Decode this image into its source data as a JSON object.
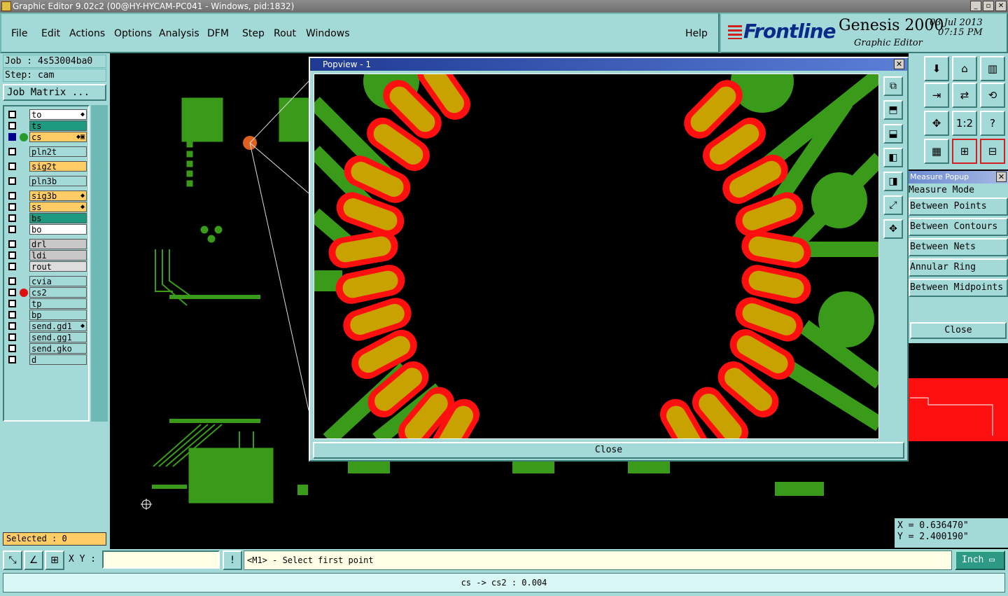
{
  "window": {
    "title": "Graphic Editor 9.02c2 (00@HY-HYCAM-PC041 - Windows, pid:1832)"
  },
  "menu": [
    {
      "label": "File"
    },
    {
      "label": "Edit"
    },
    {
      "label": "Actions"
    },
    {
      "label": "Options"
    },
    {
      "label": "Analysis"
    },
    {
      "label": "DFM"
    },
    {
      "label": "Step"
    },
    {
      "label": "Rout"
    },
    {
      "label": "Windows"
    },
    {
      "label": "Help"
    }
  ],
  "brand": {
    "logo": "Frontline",
    "product": "Genesis 2000",
    "date": "03 Jul 2013",
    "time": "07:15 PM",
    "subtitle": "Graphic Editor"
  },
  "job": {
    "job_label": "Job : 4s53004ba0",
    "step_label": "Step: cam",
    "matrix_button": "Job Matrix ..."
  },
  "layers": [
    {
      "name": "to",
      "color": "#ffffff",
      "dot": "",
      "flag": "◆",
      "selected": false
    },
    {
      "name": "ts",
      "color": "#1d9a80",
      "dot": "",
      "flag": "",
      "selected": false
    },
    {
      "name": "cs",
      "color": "#ffcc66",
      "dot": "#2a9a2a",
      "flag": "◆▣",
      "selected": true
    },
    {
      "name": "pln2t",
      "color": "#a3dad8",
      "dot": "",
      "flag": "",
      "selected": false
    },
    {
      "name": "sig2t",
      "color": "#ffcc66",
      "dot": "",
      "flag": "",
      "selected": false
    },
    {
      "name": "pln3b",
      "color": "#a3dad8",
      "dot": "",
      "flag": "",
      "selected": false
    },
    {
      "name": "sig3b",
      "color": "#ffcc66",
      "dot": "",
      "flag": "◆",
      "selected": false
    },
    {
      "name": "ss",
      "color": "#ffcc66",
      "dot": "",
      "flag": "◆",
      "selected": false
    },
    {
      "name": "bs",
      "color": "#1d9a80",
      "dot": "",
      "flag": "",
      "selected": false
    },
    {
      "name": "bo",
      "color": "#ffffff",
      "dot": "",
      "flag": "",
      "selected": false
    },
    {
      "name": "drl",
      "color": "#c8c8c8",
      "dot": "",
      "flag": "",
      "selected": false
    },
    {
      "name": "ldi",
      "color": "#c8c8c8",
      "dot": "",
      "flag": "",
      "selected": false
    },
    {
      "name": "rout",
      "color": "#dddddd",
      "dot": "",
      "flag": "",
      "selected": false
    },
    {
      "name": "cvia",
      "color": "#a3dad8",
      "dot": "",
      "flag": "",
      "selected": false
    },
    {
      "name": "cs2",
      "color": "#a3dad8",
      "dot": "#e01010",
      "flag": "",
      "selected": false
    },
    {
      "name": "tp",
      "color": "#a3dad8",
      "dot": "",
      "flag": "",
      "selected": false
    },
    {
      "name": "bp",
      "color": "#a3dad8",
      "dot": "",
      "flag": "",
      "selected": false
    },
    {
      "name": "send.gd1",
      "color": "#a3dad8",
      "dot": "",
      "flag": "◆",
      "selected": false
    },
    {
      "name": "send.gg1",
      "color": "#a3dad8",
      "dot": "",
      "flag": "",
      "selected": false
    },
    {
      "name": "send.gko",
      "color": "#a3dad8",
      "dot": "",
      "flag": "",
      "selected": false
    },
    {
      "name": "d",
      "color": "#a3dad8",
      "dot": "",
      "flag": "",
      "selected": false
    }
  ],
  "selected_label": "Selected : 0",
  "popview": {
    "title": "Popview - 1",
    "close_label": "Close"
  },
  "right_tools": [
    {
      "icon": "save-icon"
    },
    {
      "icon": "home-icon"
    },
    {
      "icon": "window-icon"
    },
    {
      "icon": "export-icon"
    },
    {
      "icon": "swap-icon"
    },
    {
      "icon": "snap-icon"
    },
    {
      "icon": "fit-icon"
    },
    {
      "icon": "scale-label",
      "text": "1:2"
    },
    {
      "icon": "help-icon",
      "text": "?"
    },
    {
      "icon": "grid-icon"
    },
    {
      "icon": "measure-icon"
    },
    {
      "icon": "measure-icon-2"
    }
  ],
  "measure": {
    "title": "Measure Popup",
    "mode_label": "Measure Mode",
    "options": [
      "Between Points",
      "Between Contours",
      "Between Nets",
      "Annular Ring",
      "Between Midpoints"
    ],
    "close_label": "Close"
  },
  "coords": {
    "x": "X = 0.636470\"",
    "y": "Y = 2.400190\""
  },
  "cmd": {
    "xy_label": "X Y :",
    "xy_value": "",
    "warn": "!",
    "prompt": "<M1> - Select first point",
    "unit": "Inch"
  },
  "status": "cs -> cs2 : 0.004"
}
